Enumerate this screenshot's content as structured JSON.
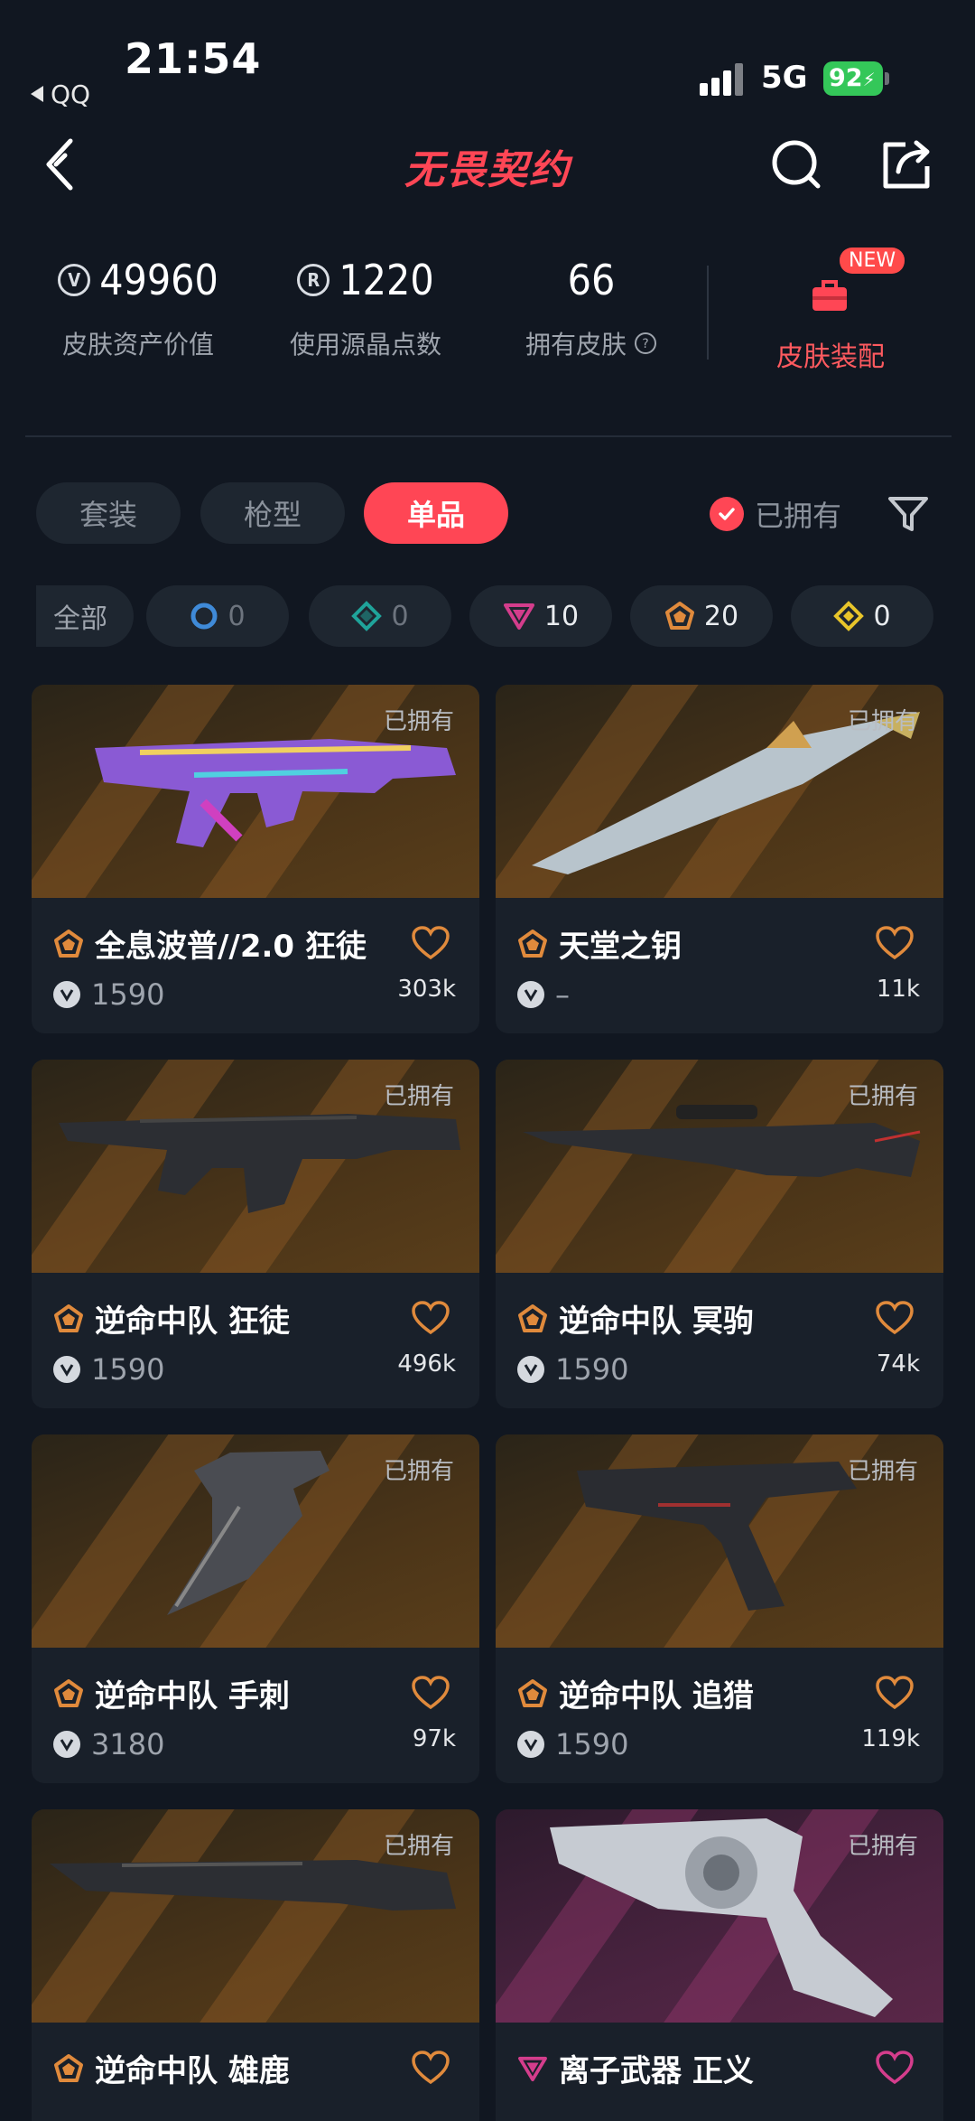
{
  "status_bar": {
    "time": "21:54",
    "back_app": "QQ",
    "network": "5G",
    "battery": "92"
  },
  "header": {
    "title": "无畏契约"
  },
  "stats": {
    "asset_value": "49960",
    "asset_label": "皮肤资产价值",
    "points_used": "1220",
    "points_label": "使用源晶点数",
    "skins_owned": "66",
    "skins_label": "拥有皮肤",
    "new_badge": "NEW",
    "loadout_label": "皮肤装配"
  },
  "tabs": [
    "套装",
    "枪型",
    "单品"
  ],
  "active_tab": "单品",
  "owned_filter": "已拥有",
  "tiers": [
    {
      "label": "全部",
      "count": ""
    },
    {
      "label": "select",
      "count": "0",
      "color": "#3f8ad8"
    },
    {
      "label": "deluxe",
      "count": "0",
      "color": "#1fa39a"
    },
    {
      "label": "premium",
      "count": "10",
      "color": "#d43d8c"
    },
    {
      "label": "exclusive",
      "count": "20",
      "color": "#e08a3c"
    },
    {
      "label": "ultra",
      "count": "0",
      "color": "#e8c52a"
    }
  ],
  "cards": [
    {
      "name": "全息波普//2.0 狂徒",
      "price": "1590",
      "likes": "303k",
      "owned": "已拥有",
      "tier_color": "#e08a3c"
    },
    {
      "name": "天堂之钥",
      "price": "–",
      "likes": "11k",
      "owned": "已拥有",
      "tier_color": "#e08a3c"
    },
    {
      "name": "逆命中队 狂徒",
      "price": "1590",
      "likes": "496k",
      "owned": "已拥有",
      "tier_color": "#e08a3c"
    },
    {
      "name": "逆命中队 冥驹",
      "price": "1590",
      "likes": "74k",
      "owned": "已拥有",
      "tier_color": "#e08a3c"
    },
    {
      "name": "逆命中队 手刺",
      "price": "3180",
      "likes": "97k",
      "owned": "已拥有",
      "tier_color": "#e08a3c"
    },
    {
      "name": "逆命中队 追猎",
      "price": "1590",
      "likes": "119k",
      "owned": "已拥有",
      "tier_color": "#e08a3c"
    },
    {
      "name": "逆命中队 雄鹿",
      "price": "",
      "likes": "",
      "owned": "已拥有",
      "tier_color": "#e08a3c"
    },
    {
      "name": "离子武器 正义",
      "price": "",
      "likes": "",
      "owned": "已拥有",
      "tier_color": "#d43d8c"
    }
  ]
}
